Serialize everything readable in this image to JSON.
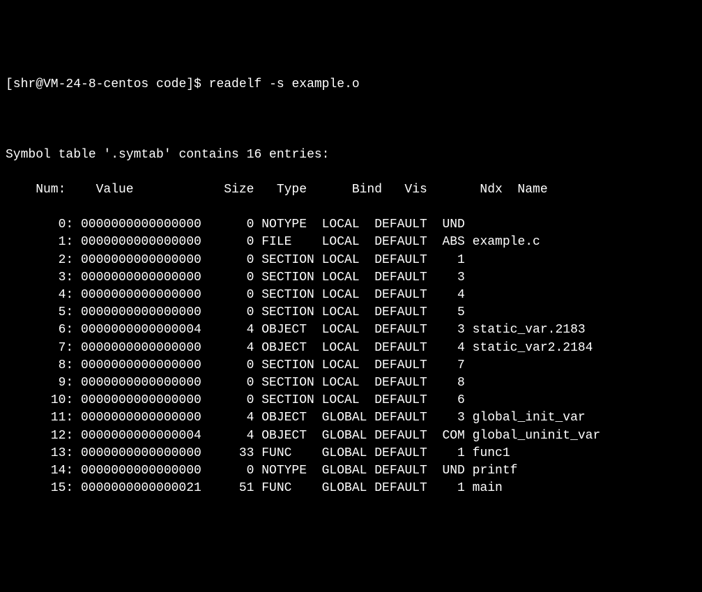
{
  "prompt": {
    "prefix": "[shr@VM-24-8-centos code]$ ",
    "command": "readelf -s example.o"
  },
  "summary": "Symbol table '.symtab' contains 16 entries:",
  "headers": {
    "num": "Num:",
    "value": "Value",
    "size": "Size",
    "type": "Type",
    "bind": "Bind",
    "vis": "Vis",
    "ndx": "Ndx",
    "name": "Name"
  },
  "rows": [
    {
      "num": "0",
      "value": "0000000000000000",
      "size": "0",
      "type": "NOTYPE",
      "bind": "LOCAL",
      "vis": "DEFAULT",
      "ndx": "UND",
      "name": ""
    },
    {
      "num": "1",
      "value": "0000000000000000",
      "size": "0",
      "type": "FILE",
      "bind": "LOCAL",
      "vis": "DEFAULT",
      "ndx": "ABS",
      "name": "example.c"
    },
    {
      "num": "2",
      "value": "0000000000000000",
      "size": "0",
      "type": "SECTION",
      "bind": "LOCAL",
      "vis": "DEFAULT",
      "ndx": "1",
      "name": ""
    },
    {
      "num": "3",
      "value": "0000000000000000",
      "size": "0",
      "type": "SECTION",
      "bind": "LOCAL",
      "vis": "DEFAULT",
      "ndx": "3",
      "name": ""
    },
    {
      "num": "4",
      "value": "0000000000000000",
      "size": "0",
      "type": "SECTION",
      "bind": "LOCAL",
      "vis": "DEFAULT",
      "ndx": "4",
      "name": ""
    },
    {
      "num": "5",
      "value": "0000000000000000",
      "size": "0",
      "type": "SECTION",
      "bind": "LOCAL",
      "vis": "DEFAULT",
      "ndx": "5",
      "name": ""
    },
    {
      "num": "6",
      "value": "0000000000000004",
      "size": "4",
      "type": "OBJECT",
      "bind": "LOCAL",
      "vis": "DEFAULT",
      "ndx": "3",
      "name": "static_var.2183"
    },
    {
      "num": "7",
      "value": "0000000000000000",
      "size": "4",
      "type": "OBJECT",
      "bind": "LOCAL",
      "vis": "DEFAULT",
      "ndx": "4",
      "name": "static_var2.2184"
    },
    {
      "num": "8",
      "value": "0000000000000000",
      "size": "0",
      "type": "SECTION",
      "bind": "LOCAL",
      "vis": "DEFAULT",
      "ndx": "7",
      "name": ""
    },
    {
      "num": "9",
      "value": "0000000000000000",
      "size": "0",
      "type": "SECTION",
      "bind": "LOCAL",
      "vis": "DEFAULT",
      "ndx": "8",
      "name": ""
    },
    {
      "num": "10",
      "value": "0000000000000000",
      "size": "0",
      "type": "SECTION",
      "bind": "LOCAL",
      "vis": "DEFAULT",
      "ndx": "6",
      "name": ""
    },
    {
      "num": "11",
      "value": "0000000000000000",
      "size": "4",
      "type": "OBJECT",
      "bind": "GLOBAL",
      "vis": "DEFAULT",
      "ndx": "3",
      "name": "global_init_var"
    },
    {
      "num": "12",
      "value": "0000000000000004",
      "size": "4",
      "type": "OBJECT",
      "bind": "GLOBAL",
      "vis": "DEFAULT",
      "ndx": "COM",
      "name": "global_uninit_var"
    },
    {
      "num": "13",
      "value": "0000000000000000",
      "size": "33",
      "type": "FUNC",
      "bind": "GLOBAL",
      "vis": "DEFAULT",
      "ndx": "1",
      "name": "func1"
    },
    {
      "num": "14",
      "value": "0000000000000000",
      "size": "0",
      "type": "NOTYPE",
      "bind": "GLOBAL",
      "vis": "DEFAULT",
      "ndx": "UND",
      "name": "printf"
    },
    {
      "num": "15",
      "value": "0000000000000021",
      "size": "51",
      "type": "FUNC",
      "bind": "GLOBAL",
      "vis": "DEFAULT",
      "ndx": "1",
      "name": "main"
    }
  ]
}
